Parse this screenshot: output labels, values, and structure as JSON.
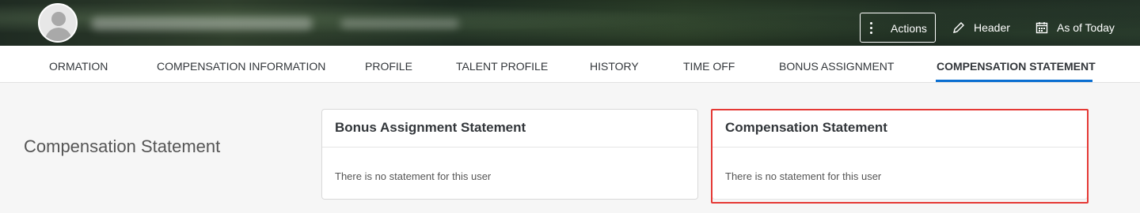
{
  "header": {
    "actions_label": "Actions",
    "header_label": "Header",
    "as_of_label": "As of Today"
  },
  "tabs": [
    {
      "label": "ORMATION"
    },
    {
      "label": "COMPENSATION INFORMATION"
    },
    {
      "label": "PROFILE"
    },
    {
      "label": "TALENT PROFILE"
    },
    {
      "label": "HISTORY"
    },
    {
      "label": "TIME OFF"
    },
    {
      "label": "BONUS ASSIGNMENT"
    },
    {
      "label": "COMPENSATION STATEMENT",
      "active": true
    }
  ],
  "main": {
    "section_title": "Compensation Statement",
    "cards": [
      {
        "title": "Bonus Assignment Statement",
        "message": "There is no statement for this user"
      },
      {
        "title": "Compensation Statement",
        "message": "There is no statement for this user"
      }
    ]
  },
  "colors": {
    "accent": "#0a6ed1",
    "highlight": "#e53935"
  }
}
